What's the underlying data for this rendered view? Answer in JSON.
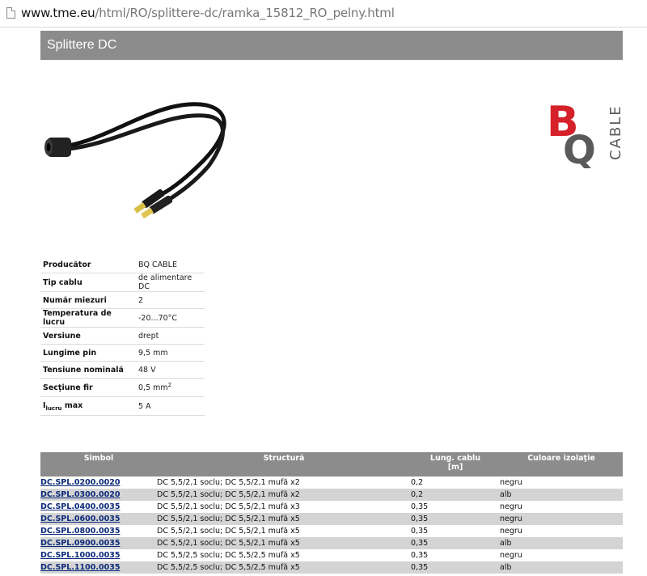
{
  "browser": {
    "url_host": "www.tme.eu",
    "url_path": "/html/RO/splittere-dc/ramka_15812_RO_pelny.html"
  },
  "page": {
    "title": "Splittere DC"
  },
  "logo": {
    "letters_main": "BQ",
    "letters_side": "CABLE",
    "colors": {
      "red": "#d6202a",
      "gray": "#5a5a5a"
    }
  },
  "specs": [
    {
      "label": "Producător",
      "value": "BQ CABLE"
    },
    {
      "label": "Tip cablu",
      "value": "de alimentare DC"
    },
    {
      "label": "Număr miezuri",
      "value": "2"
    },
    {
      "label": "Temperatura de lucru",
      "value": "-20...70°C"
    },
    {
      "label": "Versiune",
      "value": "drept"
    },
    {
      "label": "Lungime pin",
      "value": "9,5 mm"
    },
    {
      "label": "Tensiune nominală",
      "value": "48 V"
    },
    {
      "label": "Secţiune fir",
      "value": "0,5 mm",
      "value_sup": "2"
    },
    {
      "label": "I",
      "label_sub": "lucru",
      "label_rest": " max",
      "value": "5 A"
    }
  ],
  "products": {
    "headers": {
      "symbol": "Simbol",
      "structure": "Structură",
      "length": "Lung. cablu",
      "length_unit": "[m]",
      "color": "Culoare izolaţie"
    },
    "rows": [
      {
        "symbol": "DC.SPL.0200.0020",
        "structure": "DC 5,5/2,1 soclu; DC 5,5/2,1 mufă x2",
        "length": "0,2",
        "color": "negru"
      },
      {
        "symbol": "DC.SPL.0300.0020",
        "structure": "DC 5,5/2,1 soclu; DC 5,5/2,1 mufă x2",
        "length": "0,2",
        "color": "alb"
      },
      {
        "symbol": "DC.SPL.0400.0035",
        "structure": "DC 5,5/2,1 soclu; DC 5,5/2,1 mufă x3",
        "length": "0,35",
        "color": "negru"
      },
      {
        "symbol": "DC.SPL.0600.0035",
        "structure": "DC 5,5/2,1 soclu; DC 5,5/2,1 mufă x5",
        "length": "0,35",
        "color": "negru"
      },
      {
        "symbol": "DC.SPL.0800.0035",
        "structure": "DC 5,5/2,1 soclu; DC 5,5/2,1 mufă x5",
        "length": "0,35",
        "color": "negru"
      },
      {
        "symbol": "DC.SPL.0900.0035",
        "structure": "DC 5,5/2,1 soclu; DC 5,5/2,1 mufă x5",
        "length": "0,35",
        "color": "alb"
      },
      {
        "symbol": "DC.SPL.1000.0035",
        "structure": "DC 5,5/2,5 soclu; DC 5,5/2,5 mufă x5",
        "length": "0,35",
        "color": "negru"
      },
      {
        "symbol": "DC.SPL.1100.0035",
        "structure": "DC 5,5/2,5 soclu; DC 5,5/2,5 mufă x5",
        "length": "0,35",
        "color": "alb"
      }
    ]
  }
}
